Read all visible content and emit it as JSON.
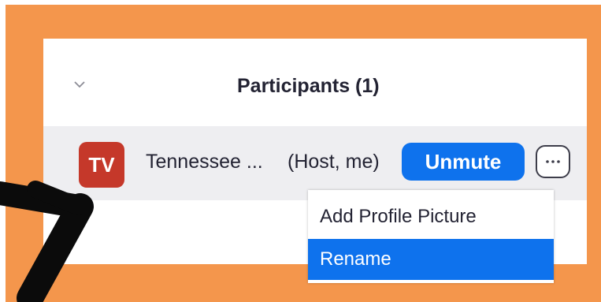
{
  "panel": {
    "title": "Participants (1)"
  },
  "participant": {
    "initials": "TV",
    "name": "Tennessee ...",
    "role": "(Host, me)",
    "unmute_label": "Unmute",
    "more_label": "···"
  },
  "menu": {
    "items": [
      {
        "label": "Add Profile Picture"
      },
      {
        "label": "Rename"
      }
    ]
  },
  "colors": {
    "frame": "#f4964c",
    "accent": "#0e72ed",
    "avatar": "#c5382a",
    "row_bg": "#eeeef1"
  },
  "icons": {
    "collapse": "chevron-down-icon",
    "annotation": "arrow-icon"
  }
}
